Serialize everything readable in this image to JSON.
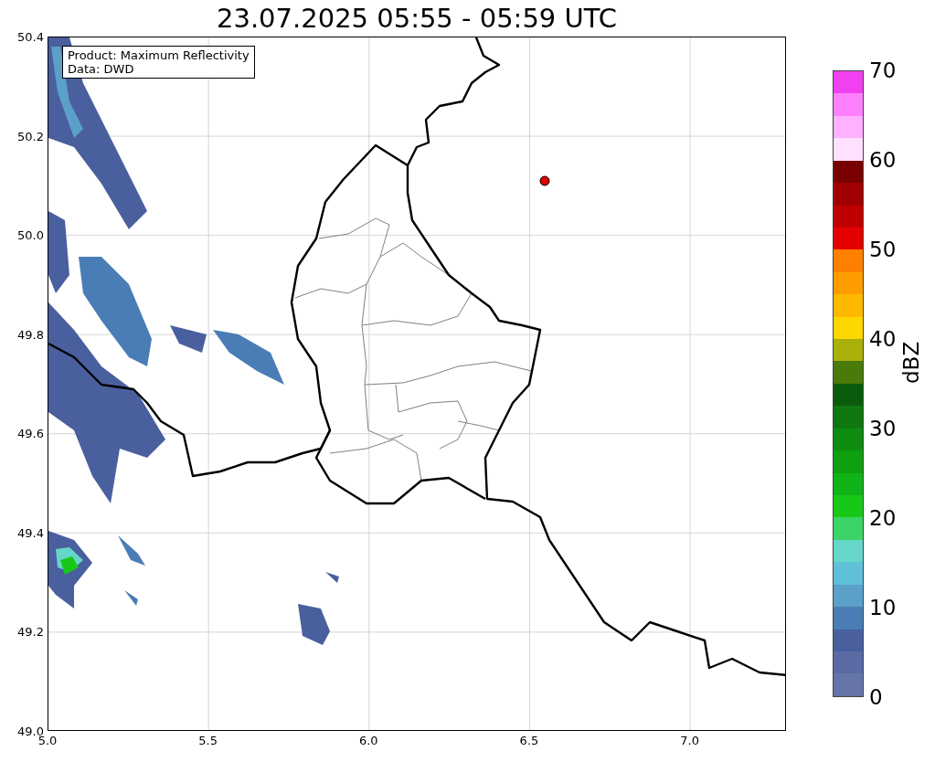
{
  "title": "23.07.2025 05:55 - 05:59 UTC",
  "info_box": {
    "lines": [
      "Product: Maximum Reflectivity",
      "Data: DWD"
    ]
  },
  "map": {
    "xticks": [
      "5.0",
      "5.5",
      "6.0",
      "6.5",
      "7.0"
    ],
    "yticks": [
      "50.4",
      "50.2",
      "50.0",
      "49.8",
      "49.6",
      "49.4",
      "49.2",
      "49.0"
    ]
  },
  "colorbar": {
    "label": "dBZ",
    "ticks": [
      "70",
      "60",
      "50",
      "40",
      "30",
      "20",
      "10",
      "0"
    ],
    "segments": [
      {
        "color": "#f040f0"
      },
      {
        "color": "#ff80ff"
      },
      {
        "color": "#ffb0ff"
      },
      {
        "color": "#ffe0ff"
      },
      {
        "color": "#780000"
      },
      {
        "color": "#a00000"
      },
      {
        "color": "#c00000"
      },
      {
        "color": "#e40000"
      },
      {
        "color": "#ff8000"
      },
      {
        "color": "#ff9c00"
      },
      {
        "color": "#ffb800"
      },
      {
        "color": "#ffd700"
      },
      {
        "color": "#aab00a"
      },
      {
        "color": "#4a7a0a"
      },
      {
        "color": "#0a5c0a"
      },
      {
        "color": "#107810"
      },
      {
        "color": "#0e8c10"
      },
      {
        "color": "#0ea010"
      },
      {
        "color": "#10b418"
      },
      {
        "color": "#18c818"
      },
      {
        "color": "#3cd468"
      },
      {
        "color": "#65d6c8"
      },
      {
        "color": "#60c0d8"
      },
      {
        "color": "#5aa0c8"
      },
      {
        "color": "#4a7db5"
      },
      {
        "color": "#4a5f9e"
      },
      {
        "color": "#5a6aa5"
      },
      {
        "color": "#6675a8"
      }
    ]
  }
}
